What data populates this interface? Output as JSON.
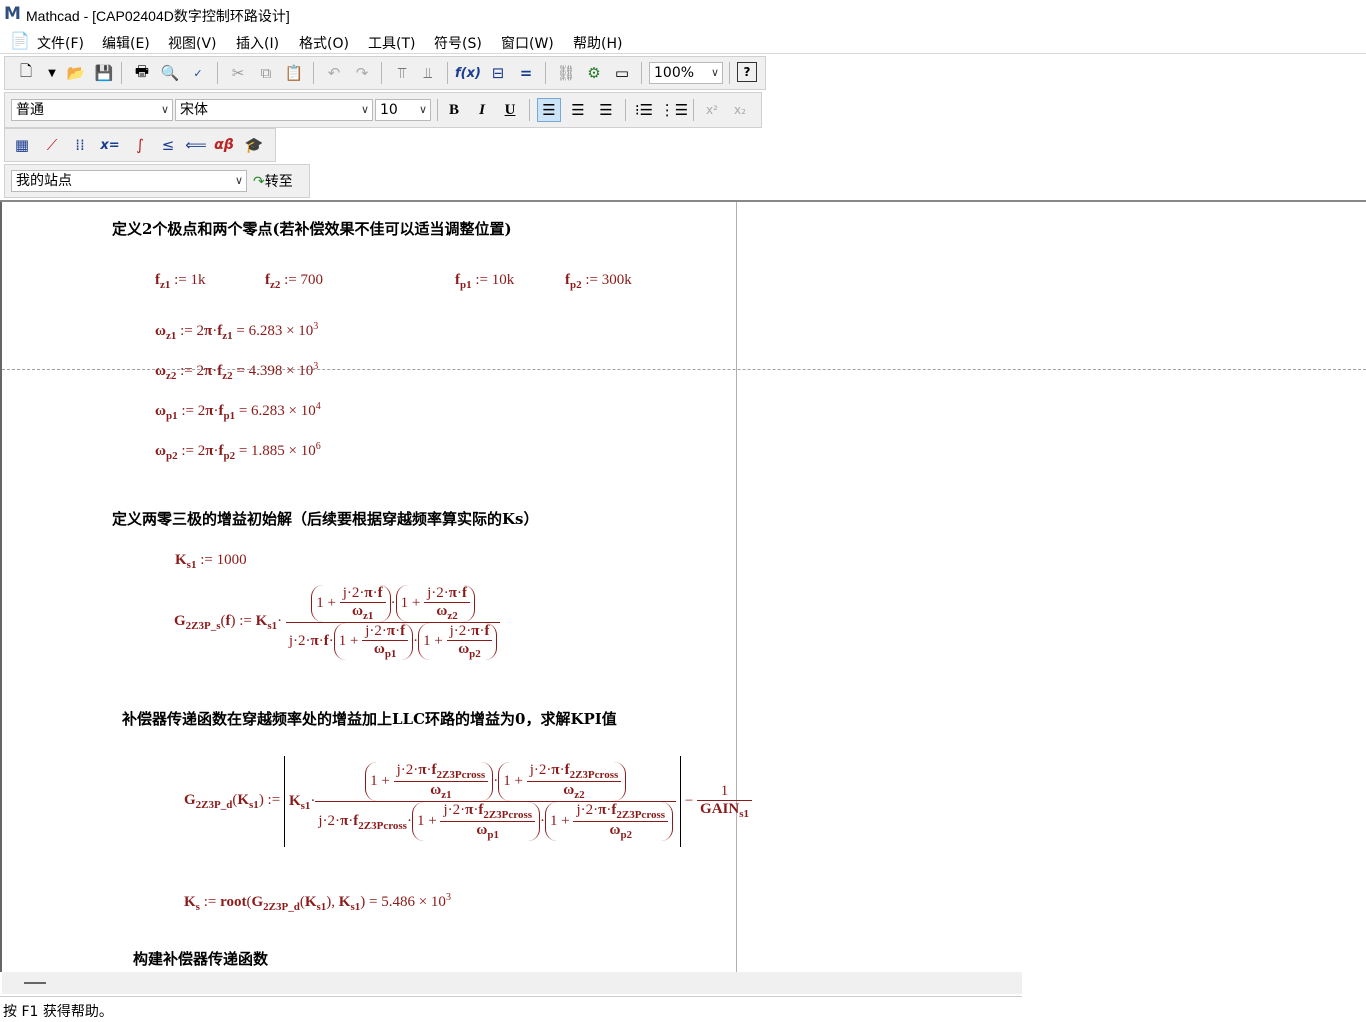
{
  "window": {
    "title": "Mathcad - [CAP02404D数字控制环路设计]",
    "logo": "M"
  },
  "menu": [
    "文件(F)",
    "编辑(E)",
    "视图(V)",
    "插入(I)",
    "格式(O)",
    "工具(T)",
    "符号(S)",
    "窗口(W)",
    "帮助(H)"
  ],
  "toolbar": {
    "zoom": "100%",
    "style": "普通",
    "font": "宋体",
    "size": "10",
    "bold": "B",
    "italic": "I",
    "underline": "U",
    "site": "我的站点",
    "go": "转至"
  },
  "worksheet": {
    "heading1": "定义2个极点和两个零点(若补偿效果不佳可以适当调整位置)",
    "fz1": {
      "var": "f",
      "sub": "z1",
      "val": "1k"
    },
    "fz2": {
      "var": "f",
      "sub": "z2",
      "val": "700"
    },
    "fp1": {
      "var": "f",
      "sub": "p1",
      "val": "10k"
    },
    "fp2": {
      "var": "f",
      "sub": "p2",
      "val": "300k"
    },
    "wz1": {
      "sub": "z1",
      "res": "6.283 × 10",
      "exp": "3"
    },
    "wz2": {
      "sub": "z2",
      "res": "4.398 × 10",
      "exp": "3"
    },
    "wp1": {
      "sub": "p1",
      "res": "6.283 × 10",
      "exp": "4"
    },
    "wp2": {
      "sub": "p2",
      "res": "1.885 × 10",
      "exp": "6"
    },
    "heading2": "定义两零三极的增益初始解（后续要根据穿越频率算实际的Ks）",
    "ks1": "1000",
    "heading3": "补偿器传递函数在穿越频率处的增益加上LLC环路的增益为0，求解KPI值",
    "ks_result": "5.486 × 10",
    "ks_exp": "3",
    "heading4": "构建补偿器传递函数"
  },
  "status": "按 F1 获得帮助。"
}
